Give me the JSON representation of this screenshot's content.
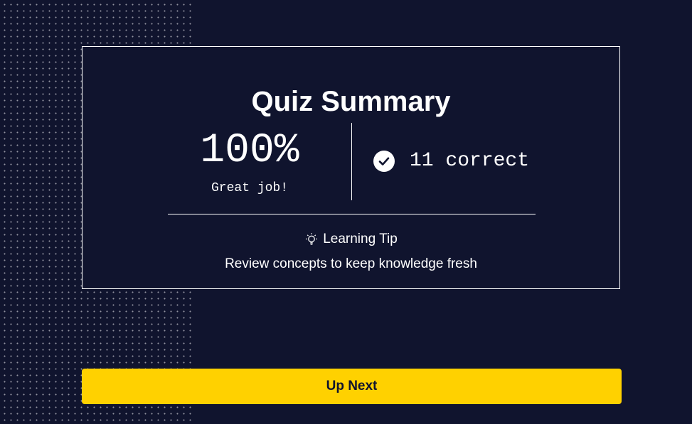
{
  "summary": {
    "title": "Quiz Summary",
    "score": "100%",
    "score_message": "Great job!",
    "correct_count": "11 correct",
    "tip_label": "Learning Tip",
    "tip_text": "Review concepts to keep knowledge fresh"
  },
  "actions": {
    "up_next_label": "Up Next"
  },
  "icons": {
    "check": "check-circle-icon",
    "tip": "lightbulb-icon"
  },
  "colors": {
    "background": "#10142e",
    "accent": "#ffd100",
    "text": "#ffffff"
  }
}
